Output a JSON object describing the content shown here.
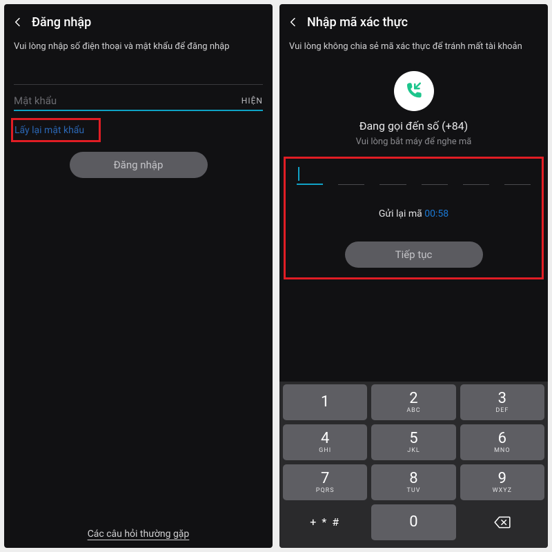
{
  "screen1": {
    "title": "Đăng nhập",
    "subtitle": "Vui lòng nhập số điện thoại và mật khẩu để đăng nhập",
    "password_placeholder": "Mật khẩu",
    "toggle_label": "HIỆN",
    "forgot_label": "Lấy lại mật khẩu",
    "login_label": "Đăng nhập",
    "faq_label": "Các câu hỏi thường gặp"
  },
  "screen2": {
    "title": "Nhập mã xác thực",
    "subtitle": "Vui lòng không chia sẻ mã xác thực để tránh mất tài khoản",
    "calling_to": "Đang gọi đến số (+84)",
    "pickup": "Vui lòng bắt máy để nghe mã",
    "resend_label": "Gửi lại mã",
    "countdown": "00:58",
    "continue_label": "Tiếp tục"
  },
  "keypad": {
    "rows": [
      [
        {
          "n": "1",
          "l": ""
        },
        {
          "n": "2",
          "l": "ABC"
        },
        {
          "n": "3",
          "l": "DEF"
        }
      ],
      [
        {
          "n": "4",
          "l": "GHI"
        },
        {
          "n": "5",
          "l": "JKL"
        },
        {
          "n": "6",
          "l": "MNO"
        }
      ],
      [
        {
          "n": "7",
          "l": "PQRS"
        },
        {
          "n": "8",
          "l": "TUV"
        },
        {
          "n": "9",
          "l": "WXYZ"
        }
      ]
    ],
    "sym": "+ * #",
    "zero": "0"
  }
}
